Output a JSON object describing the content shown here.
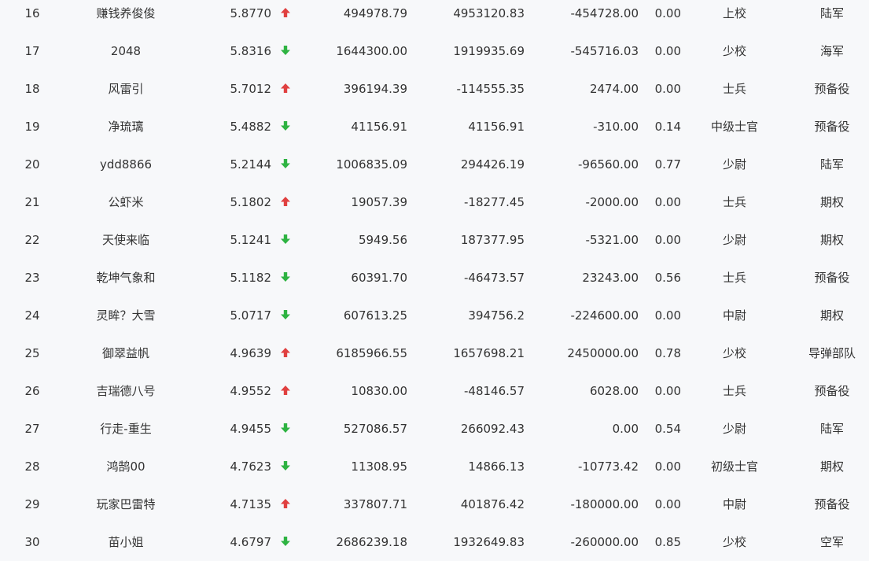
{
  "colors": {
    "up": "#e04040",
    "down": "#2eb342",
    "text": "#333333",
    "background": "#f7f8fa"
  },
  "rows": [
    {
      "rank": "16",
      "name": "赚钱养俊俊",
      "score": "5.8770",
      "trend": "up",
      "trend_icon": "arrow-up-icon",
      "v1": "494978.79",
      "v2": "4953120.83",
      "v3": "-454728.00",
      "ratio": "0.00",
      "rank_title": "上校",
      "branch": "陆军"
    },
    {
      "rank": "17",
      "name": "2048",
      "score": "5.8316",
      "trend": "down",
      "trend_icon": "arrow-down-icon",
      "v1": "1644300.00",
      "v2": "1919935.69",
      "v3": "-545716.03",
      "ratio": "0.00",
      "rank_title": "少校",
      "branch": "海军"
    },
    {
      "rank": "18",
      "name": "风雷引",
      "score": "5.7012",
      "trend": "up",
      "trend_icon": "arrow-up-icon",
      "v1": "396194.39",
      "v2": "-114555.35",
      "v3": "2474.00",
      "ratio": "0.00",
      "rank_title": "士兵",
      "branch": "预备役"
    },
    {
      "rank": "19",
      "name": "净琉璃",
      "score": "5.4882",
      "trend": "down",
      "trend_icon": "arrow-down-icon",
      "v1": "41156.91",
      "v2": "41156.91",
      "v3": "-310.00",
      "ratio": "0.14",
      "rank_title": "中级士官",
      "branch": "预备役"
    },
    {
      "rank": "20",
      "name": "ydd8866",
      "score": "5.2144",
      "trend": "down",
      "trend_icon": "arrow-down-icon",
      "v1": "1006835.09",
      "v2": "294426.19",
      "v3": "-96560.00",
      "ratio": "0.77",
      "rank_title": "少尉",
      "branch": "陆军"
    },
    {
      "rank": "21",
      "name": "公虾米",
      "score": "5.1802",
      "trend": "up",
      "trend_icon": "arrow-up-icon",
      "v1": "19057.39",
      "v2": "-18277.45",
      "v3": "-2000.00",
      "ratio": "0.00",
      "rank_title": "士兵",
      "branch": "期权"
    },
    {
      "rank": "22",
      "name": "天使来临",
      "score": "5.1241",
      "trend": "down",
      "trend_icon": "arrow-down-icon",
      "v1": "5949.56",
      "v2": "187377.95",
      "v3": "-5321.00",
      "ratio": "0.00",
      "rank_title": "少尉",
      "branch": "期权"
    },
    {
      "rank": "23",
      "name": "乾坤气象和",
      "score": "5.1182",
      "trend": "down",
      "trend_icon": "arrow-down-icon",
      "v1": "60391.70",
      "v2": "-46473.57",
      "v3": "23243.00",
      "ratio": "0.56",
      "rank_title": "士兵",
      "branch": "预备役"
    },
    {
      "rank": "24",
      "name": "灵眸？大雪",
      "score": "5.0717",
      "trend": "down",
      "trend_icon": "arrow-down-icon",
      "v1": "607613.25",
      "v2": "394756.2",
      "v3": "-224600.00",
      "ratio": "0.00",
      "rank_title": "中尉",
      "branch": "期权"
    },
    {
      "rank": "25",
      "name": "御翠益帆",
      "score": "4.9639",
      "trend": "up",
      "trend_icon": "arrow-up-icon",
      "v1": "6185966.55",
      "v2": "1657698.21",
      "v3": "2450000.00",
      "ratio": "0.78",
      "rank_title": "少校",
      "branch": "导弹部队"
    },
    {
      "rank": "26",
      "name": "吉瑞德八号",
      "score": "4.9552",
      "trend": "up",
      "trend_icon": "arrow-up-icon",
      "v1": "10830.00",
      "v2": "-48146.57",
      "v3": "6028.00",
      "ratio": "0.00",
      "rank_title": "士兵",
      "branch": "预备役"
    },
    {
      "rank": "27",
      "name": "行走-重生",
      "score": "4.9455",
      "trend": "down",
      "trend_icon": "arrow-down-icon",
      "v1": "527086.57",
      "v2": "266092.43",
      "v3": "0.00",
      "ratio": "0.54",
      "rank_title": "少尉",
      "branch": "陆军"
    },
    {
      "rank": "28",
      "name": "鸿鹄00",
      "score": "4.7623",
      "trend": "down",
      "trend_icon": "arrow-down-icon",
      "v1": "11308.95",
      "v2": "14866.13",
      "v3": "-10773.42",
      "ratio": "0.00",
      "rank_title": "初级士官",
      "branch": "期权"
    },
    {
      "rank": "29",
      "name": "玩家巴雷特",
      "score": "4.7135",
      "trend": "up",
      "trend_icon": "arrow-up-icon",
      "v1": "337807.71",
      "v2": "401876.42",
      "v3": "-180000.00",
      "ratio": "0.00",
      "rank_title": "中尉",
      "branch": "预备役"
    },
    {
      "rank": "30",
      "name": "苗小姐",
      "score": "4.6797",
      "trend": "down",
      "trend_icon": "arrow-down-icon",
      "v1": "2686239.18",
      "v2": "1932649.83",
      "v3": "-260000.00",
      "ratio": "0.85",
      "rank_title": "少校",
      "branch": "空军"
    }
  ]
}
